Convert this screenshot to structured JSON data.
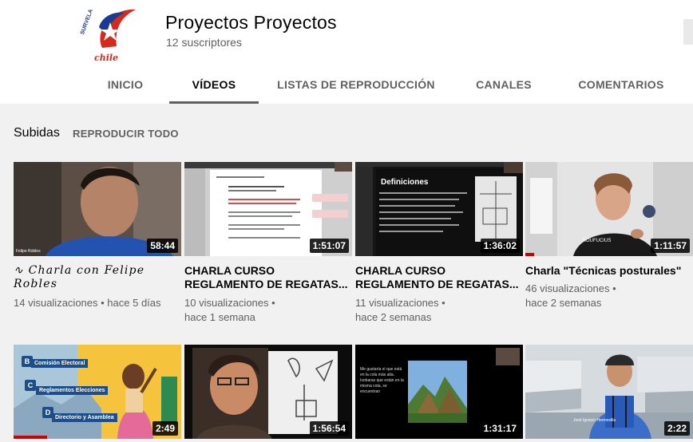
{
  "channel": {
    "name": "Proyectos Proyectos",
    "subscribers": "12 suscriptores",
    "logo_text_top": "SURVELA",
    "logo_text_bottom": "chile"
  },
  "tabs": [
    {
      "label": "INICIO",
      "active": false
    },
    {
      "label": "VÍDEOS",
      "active": true
    },
    {
      "label": "LISTAS DE REPRODUCCIÓN",
      "active": false
    },
    {
      "label": "CANALES",
      "active": false
    },
    {
      "label": "COMENTARIOS",
      "active": false
    }
  ],
  "section": {
    "title": "Subidas",
    "play_all": "REPRODUCIR TODO"
  },
  "videos": [
    {
      "title_prefix": "∿",
      "title": "Charla con Felipe Robles",
      "duration": "58:44",
      "views": "14 visualizaciones",
      "age": "hace 5 días",
      "thumb_caption": "Felipe Robles",
      "watched_fraction": 0
    },
    {
      "title": "CHARLA CURSO REGLAMENTO DE REGATAS...",
      "duration": "1:51:07",
      "views": "10 visualizaciones",
      "age": "hace 1 semana",
      "watched_fraction": 0
    },
    {
      "title": "CHARLA CURSO REGLAMENTO DE REGATAS...",
      "duration": "1:36:02",
      "views": "11 visualizaciones",
      "age": "hace 2 semanas",
      "thumb_heading": "Definiciones",
      "watched_fraction": 0
    },
    {
      "title": "Charla \"Técnicas posturales\"",
      "duration": "1:11:57",
      "views": "46 visualizaciones",
      "age": "hace 2 semanas",
      "thumb_caption": "KOUFUCIUS",
      "watched_fraction": 0.05
    },
    {
      "duration": "2:49",
      "thumb_items": [
        "Comisión Electoral",
        "Reglamentos Elecciones",
        "Directorio y Asamblea"
      ],
      "thumb_letters": [
        "B",
        "C",
        "D"
      ],
      "watched_fraction": 0.2
    },
    {
      "duration": "1:56:54",
      "watched_fraction": 0
    },
    {
      "duration": "1:31:17",
      "thumb_text": "Me gustaría sí que está en la cola más alta. Isobaras que están en la misma cota, se encuentran",
      "watched_fraction": 0
    },
    {
      "duration": "2:22",
      "thumb_caption": "José Ignacio Hermosilla",
      "watched_fraction": 0
    }
  ]
}
